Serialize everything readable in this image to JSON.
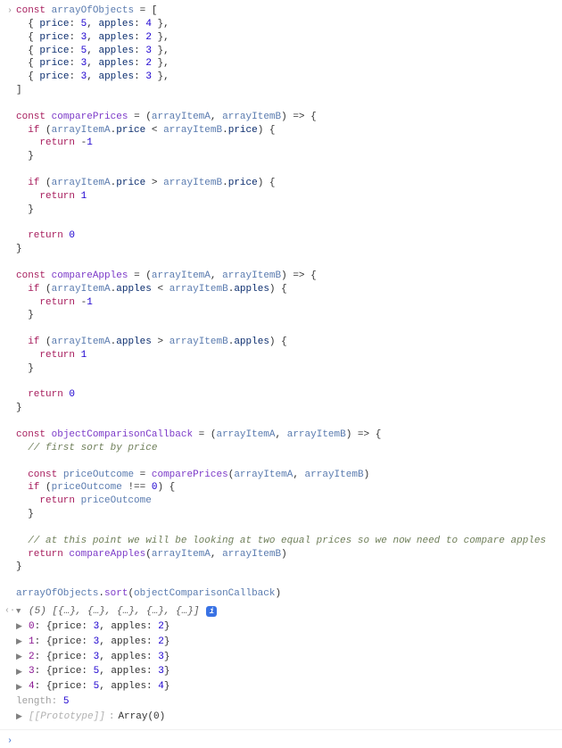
{
  "console": {
    "code": "const arrayOfObjects = [\n  { price: 5, apples: 4 },\n  { price: 3, apples: 2 },\n  { price: 5, apples: 3 },\n  { price: 3, apples: 2 },\n  { price: 3, apples: 3 },\n]\n\nconst comparePrices = (arrayItemA, arrayItemB) => {\n  if (arrayItemA.price < arrayItemB.price) {\n    return -1\n  }\n\n  if (arrayItemA.price > arrayItemB.price) {\n    return 1\n  }\n\n  return 0\n}\n\nconst compareApples = (arrayItemA, arrayItemB) => {\n  if (arrayItemA.apples < arrayItemB.apples) {\n    return -1\n  }\n\n  if (arrayItemA.apples > arrayItemB.apples) {\n    return 1\n  }\n\n  return 0\n}\n\nconst objectComparisonCallback = (arrayItemA, arrayItemB) => {\n  // first sort by price\n\n  const priceOutcome = comparePrices(arrayItemA, arrayItemB)\n  if (priceOutcome !== 0) {\n    return priceOutcome\n  }\n\n  // at this point we will be looking at two equal prices so we now need to compare apples\n  return compareApples(arrayItemA, arrayItemB)\n}\n\narrayOfObjects.sort(objectComparisonCallback)",
    "output": {
      "summary": "(5) [{…}, {…}, {…}, {…}, {…}]",
      "items": [
        {
          "index": "0",
          "price": 3,
          "apples": 2
        },
        {
          "index": "1",
          "price": 3,
          "apples": 2
        },
        {
          "index": "2",
          "price": 3,
          "apples": 3
        },
        {
          "index": "3",
          "price": 5,
          "apples": 3
        },
        {
          "index": "4",
          "price": 5,
          "apples": 4
        }
      ],
      "length_label": "length",
      "length_value": "5",
      "proto_label": "[[Prototype]]",
      "proto_value": "Array(0)"
    }
  },
  "glyphs": {
    "input_prompt": "›",
    "output_prompt": "‹·",
    "tri_down": "▼",
    "tri_right": "▶"
  }
}
